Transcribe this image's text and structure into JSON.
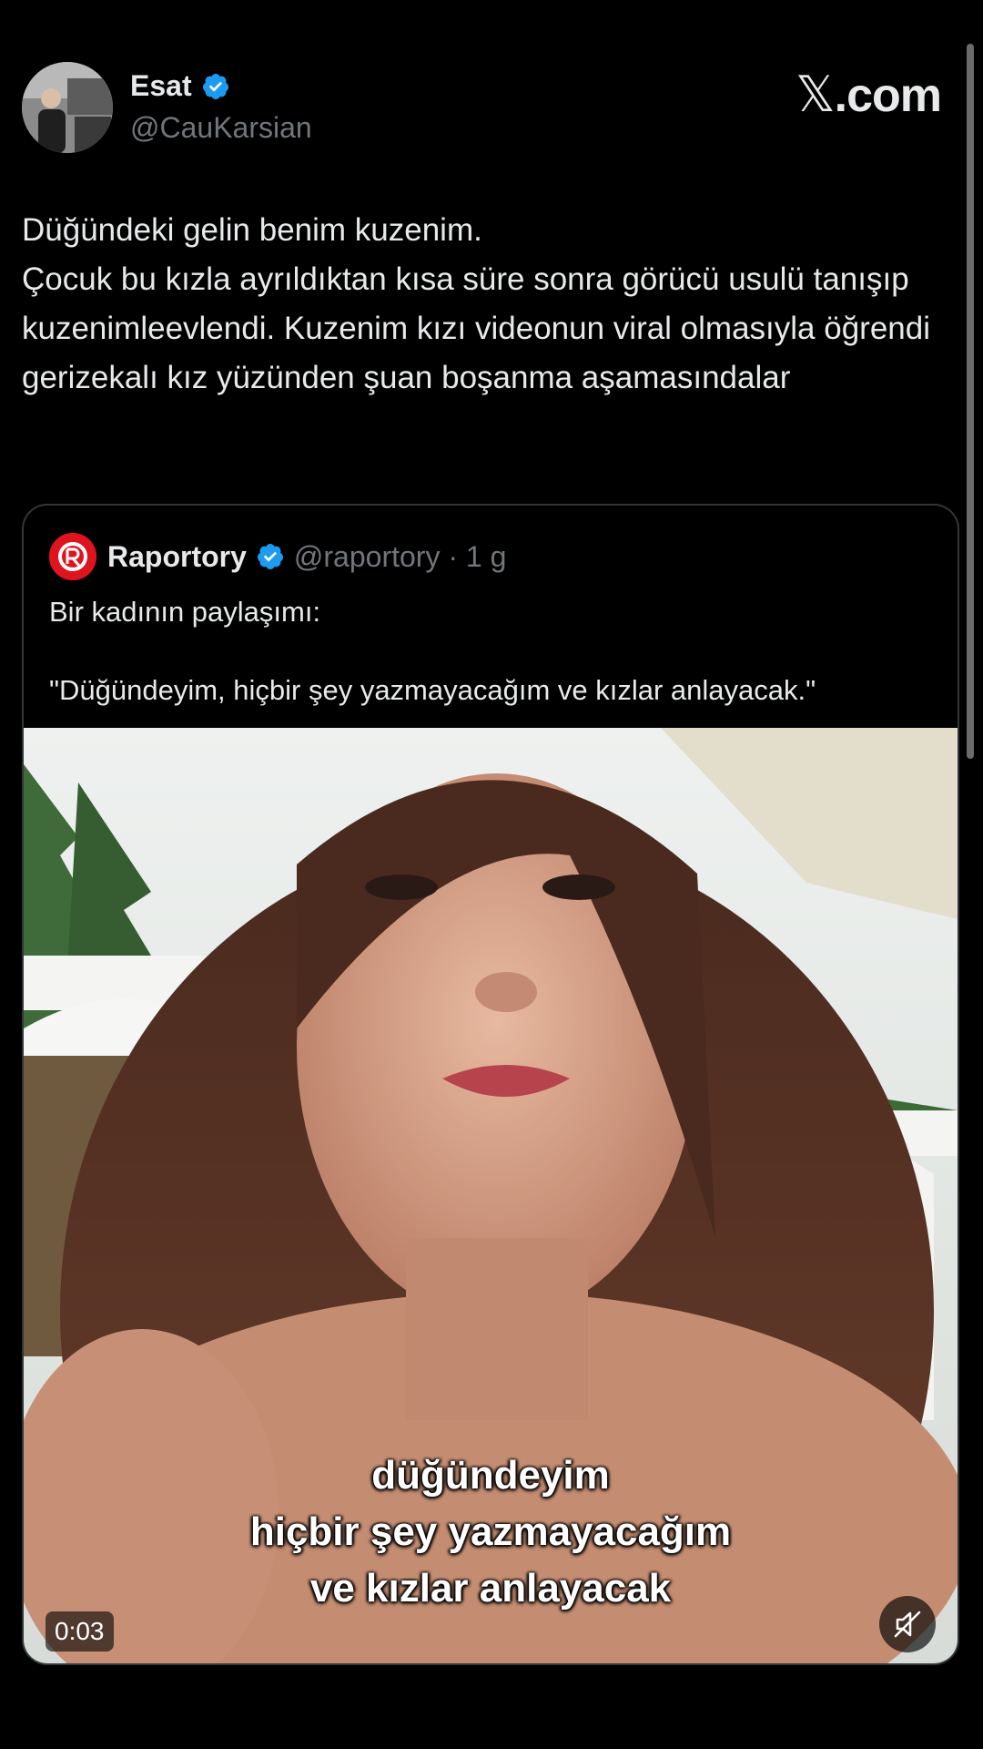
{
  "author": {
    "name": "Esat",
    "handle": "@CauKarsian",
    "verified": true
  },
  "brand": {
    "x": "𝕏",
    "domain": ".com"
  },
  "tweet": {
    "text": "Düğündeki gelin benim kuzenim.\nÇocuk bu kızla ayrıldıktan kısa süre sonra görücü usulü tanışıp kuzenimleevlendi. Kuzenim kızı videonun viral olmasıyla öğrendi  gerizekalı kız yüzünden şuan boşanma aşamasındalar"
  },
  "quote": {
    "name": "Raportory",
    "handle": "@raportory · 1 g",
    "line1": "Bir kadının paylaşımı:",
    "line2": "\"Düğündeyim, hiçbir şey yazmayacağım ve kızlar anlayacak.\""
  },
  "video": {
    "caption": "düğündeyim\nhiçbir şey yazmayacağım\nve kızlar anlayacak",
    "time": "0:03",
    "muted": true
  },
  "colors": {
    "background": "#000000",
    "text": "#e7e9ea",
    "secondary": "#71767b",
    "verified_blue": "#1d9bf0",
    "raportory_red": "#e0141e"
  }
}
